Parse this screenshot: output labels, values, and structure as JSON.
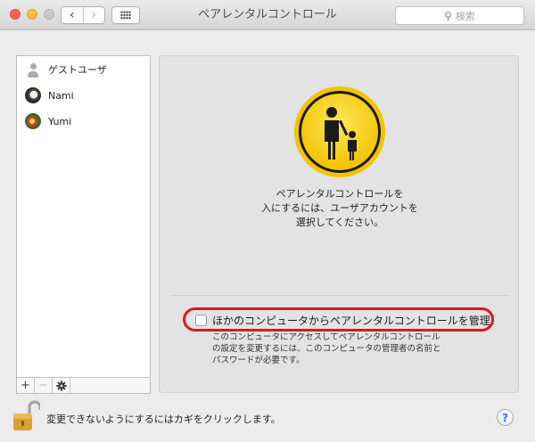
{
  "window": {
    "title": "ペアレンタルコントロール",
    "search_placeholder": "検索",
    "back_glyph": "‹",
    "forward_glyph": "›"
  },
  "users": [
    {
      "name": "ゲストユーザ",
      "icon": "guest-user-icon"
    },
    {
      "name": "Nami",
      "icon": "avatar-icon"
    },
    {
      "name": "Yumi",
      "icon": "avatar-icon"
    }
  ],
  "list_controls": {
    "add": "+",
    "remove": "−",
    "settings": "gear-icon"
  },
  "main": {
    "message_lines": [
      "ペアレンタルコントロールを",
      "入にするには、ユーザアカウントを",
      "選択してください。"
    ],
    "checkbox_label": "ほかのコンピュータからペアレンタルコントロールを管理",
    "checkbox_checked": false,
    "description_lines": [
      "このコンピュータにアクセスしてペアレンタルコントロール",
      "の設定を変更するには、このコンピュータの管理者の名前と",
      "パスワードが必要です。"
    ],
    "highlight_color": "#e01622"
  },
  "footer": {
    "lock_text": "変更できないようにするにはカギをクリックします。",
    "help": "?"
  },
  "colors": {
    "badge_yellow": "#f6d319",
    "badge_ring": "#1a1a1a"
  }
}
